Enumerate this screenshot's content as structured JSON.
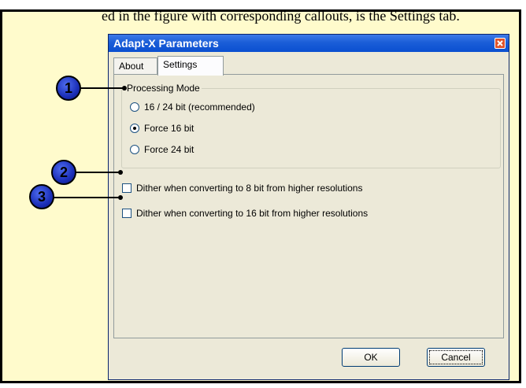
{
  "caption": "ed in the figure with corresponding callouts, is the Settings tab.",
  "dialog": {
    "title": "Adapt-X Parameters",
    "tabs": [
      {
        "label": "About",
        "active": false
      },
      {
        "label": "Settings",
        "active": true
      }
    ],
    "processing_mode": {
      "legend": "Processing Mode",
      "options": [
        {
          "label": "16 / 24 bit (recommended)",
          "selected": false
        },
        {
          "label": "Force 16 bit",
          "selected": true
        },
        {
          "label": "Force 24 bit",
          "selected": false
        }
      ]
    },
    "checkboxes": [
      {
        "label": "Dither when converting to 8 bit from higher resolutions",
        "checked": false
      },
      {
        "label": "Dither when converting to 16 bit from higher resolutions",
        "checked": false
      }
    ],
    "buttons": {
      "ok": "OK",
      "cancel": "Cancel"
    }
  },
  "callouts": [
    "1",
    "2",
    "3"
  ],
  "colors": {
    "frame_bg": "#fffbcc",
    "titlebar": "#1b5ed8",
    "dialog_bg": "#ece9d8",
    "callout_blue": "#1b2fb8"
  }
}
